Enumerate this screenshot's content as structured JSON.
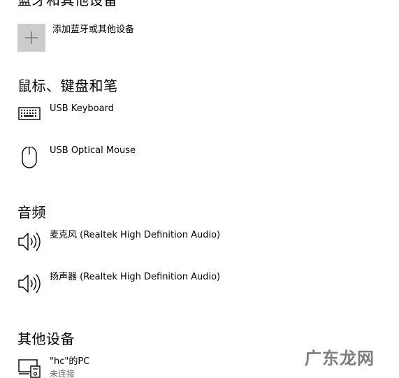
{
  "sections": {
    "bluetooth": {
      "title": "蓝牙和其他设备"
    },
    "mouse_keyboard": {
      "title": "鼠标、键盘和笔"
    },
    "audio": {
      "title": "音频"
    },
    "other": {
      "title": "其他设备"
    }
  },
  "add_device": {
    "label": "添加蓝牙或其他设备",
    "icon": "plus-icon"
  },
  "mouse_keyboard_devices": [
    {
      "name": "USB Keyboard",
      "icon": "keyboard-icon"
    },
    {
      "name": "USB Optical Mouse",
      "icon": "mouse-icon"
    }
  ],
  "audio_devices": [
    {
      "name": "麦克风 (Realtek High Definition Audio)",
      "icon": "speaker-icon"
    },
    {
      "name": "扬声器 (Realtek High Definition Audio)",
      "icon": "speaker-icon"
    }
  ],
  "other_devices": [
    {
      "name": "\"hc\"的PC",
      "status": "未连接",
      "icon": "display-device-icon"
    }
  ],
  "watermark": {
    "text": "广东龙网"
  }
}
